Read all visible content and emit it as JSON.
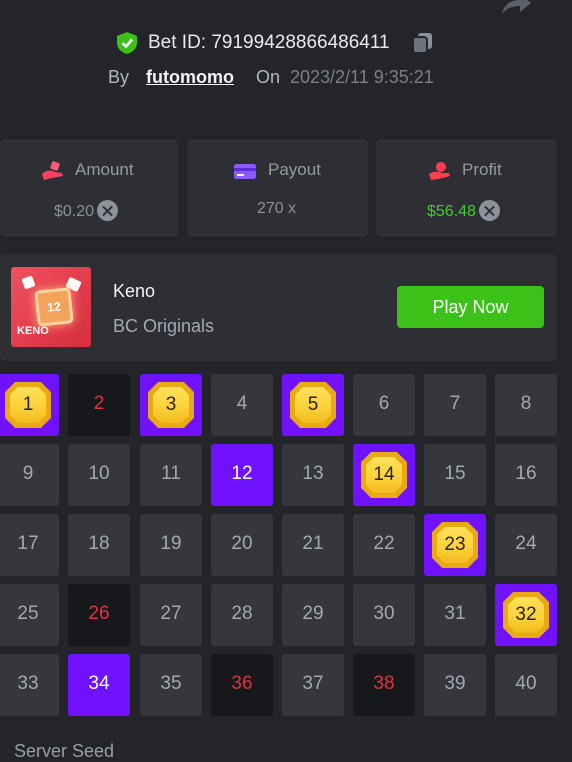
{
  "header": {
    "bet_id": "Bet ID: 79199428866486411",
    "by_label": "By",
    "username": "futomomo",
    "on_label": "On",
    "timestamp": "2023/2/11 9:35:21"
  },
  "stats": [
    {
      "label": "Amount",
      "value": "$0.20",
      "icon": "bet-hand-icon",
      "value_color": "#8c9099"
    },
    {
      "label": "Payout",
      "value": "270 x",
      "icon": "wallet-icon",
      "value_color": "#8c9099"
    },
    {
      "label": "Profit",
      "value": "$56.48",
      "icon": "profit-hand-icon",
      "value_color": "#3fd02b"
    }
  ],
  "game": {
    "name": "Keno",
    "provider": "BC Originals",
    "play_label": "Play Now",
    "thumb_number": "12",
    "thumb_label": "KENO"
  },
  "grid": {
    "tiles": [
      {
        "n": "1",
        "state": "hit"
      },
      {
        "n": "2",
        "state": "drawn"
      },
      {
        "n": "3",
        "state": "hit"
      },
      {
        "n": "4",
        "state": "none"
      },
      {
        "n": "5",
        "state": "hit"
      },
      {
        "n": "6",
        "state": "none"
      },
      {
        "n": "7",
        "state": "none"
      },
      {
        "n": "8",
        "state": "none"
      },
      {
        "n": "9",
        "state": "none"
      },
      {
        "n": "10",
        "state": "none"
      },
      {
        "n": "11",
        "state": "none"
      },
      {
        "n": "12",
        "state": "picked"
      },
      {
        "n": "13",
        "state": "none"
      },
      {
        "n": "14",
        "state": "hit"
      },
      {
        "n": "15",
        "state": "none"
      },
      {
        "n": "16",
        "state": "none"
      },
      {
        "n": "17",
        "state": "none"
      },
      {
        "n": "18",
        "state": "none"
      },
      {
        "n": "19",
        "state": "none"
      },
      {
        "n": "20",
        "state": "none"
      },
      {
        "n": "21",
        "state": "none"
      },
      {
        "n": "22",
        "state": "none"
      },
      {
        "n": "23",
        "state": "hit"
      },
      {
        "n": "24",
        "state": "none"
      },
      {
        "n": "25",
        "state": "none"
      },
      {
        "n": "26",
        "state": "drawn"
      },
      {
        "n": "27",
        "state": "none"
      },
      {
        "n": "28",
        "state": "none"
      },
      {
        "n": "29",
        "state": "none"
      },
      {
        "n": "30",
        "state": "none"
      },
      {
        "n": "31",
        "state": "none"
      },
      {
        "n": "32",
        "state": "hit"
      },
      {
        "n": "33",
        "state": "none"
      },
      {
        "n": "34",
        "state": "picked"
      },
      {
        "n": "35",
        "state": "none"
      },
      {
        "n": "36",
        "state": "drawn"
      },
      {
        "n": "37",
        "state": "none"
      },
      {
        "n": "38",
        "state": "drawn"
      },
      {
        "n": "39",
        "state": "none"
      },
      {
        "n": "40",
        "state": "none"
      }
    ]
  },
  "footer": {
    "server_seed_label": "Server Seed"
  },
  "colors": {
    "accent_green": "#3bc117",
    "picked_purple": "#7012ff",
    "drawn_red": "#e1323e",
    "gem_gold": "#fcd23a"
  }
}
